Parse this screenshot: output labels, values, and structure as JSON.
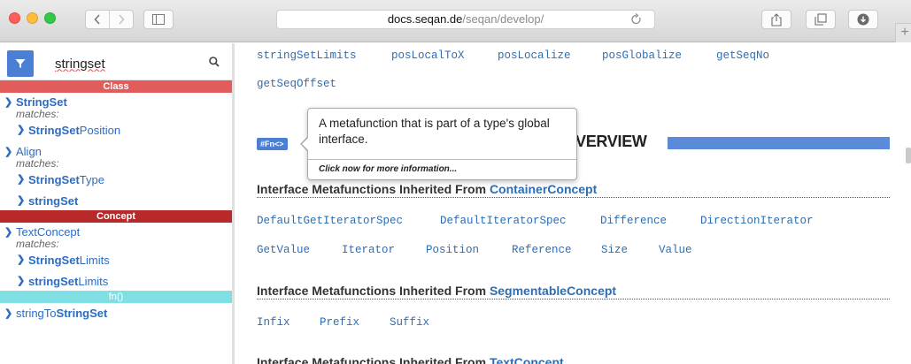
{
  "browser": {
    "url_host": "docs.seqan.de",
    "url_path": "/seqan/develop/",
    "icons": {
      "back": "chevron-left-icon",
      "forward": "chevron-right-icon",
      "sidebar": "sidebar-icon",
      "reload": "reload-icon",
      "share": "share-icon",
      "tabs": "tabs-icon",
      "download": "download-icon",
      "new_tab": "plus-icon"
    },
    "new_tab_label": "+"
  },
  "sidebar": {
    "search_value": "stringset",
    "categories": {
      "class": "Class",
      "concept": "Concept",
      "fn": "fn()"
    },
    "matches_label": "matches:",
    "results": {
      "r1": {
        "name_bold": "StringSet"
      },
      "r1_sub": {
        "bold": "StringSet",
        "rest": "Position"
      },
      "r2": {
        "name": "Align"
      },
      "r2_sub1": {
        "bold": "StringSet",
        "rest": "Type"
      },
      "r2_sub2": {
        "bold": "stringSet"
      },
      "r3": {
        "name": "TextConcept"
      },
      "r3_sub1": {
        "bold": "StringSet",
        "rest": "Limits"
      },
      "r3_sub2": {
        "bold": "stringSet",
        "rest": "Limits"
      },
      "r4": {
        "pre": "stringTo",
        "bold": "StringSet"
      }
    },
    "arrow": "❯"
  },
  "main": {
    "top_links": [
      "stringSetLimits",
      "posLocalToX",
      "posLocalize",
      "posGlobalize",
      "getSeqNo"
    ],
    "top_link_2": "getSeqOffset",
    "fn_badge": "#Fn<>",
    "overview_title": "VERVIEW",
    "tooltip": {
      "text": "A metafunction that is part of a type's global interface.",
      "more": "Click now for more information..."
    },
    "section1": {
      "prefix": "Interface Metafunctions Inherited From ",
      "concept": "ContainerConcept",
      "row1": [
        "DefaultGetIteratorSpec",
        "DefaultIteratorSpec",
        "Difference",
        "DirectionIterator"
      ],
      "row2": [
        "GetValue",
        "Iterator",
        "Position",
        "Reference",
        "Size",
        "Value"
      ]
    },
    "section2": {
      "prefix": "Interface Metafunctions Inherited From ",
      "concept": "SegmentableConcept",
      "row1": [
        "Infix",
        "Prefix",
        "Suffix"
      ]
    },
    "section3": {
      "prefix": "Interface Metafunctions Inherited From ",
      "concept": "TextConcept"
    }
  }
}
